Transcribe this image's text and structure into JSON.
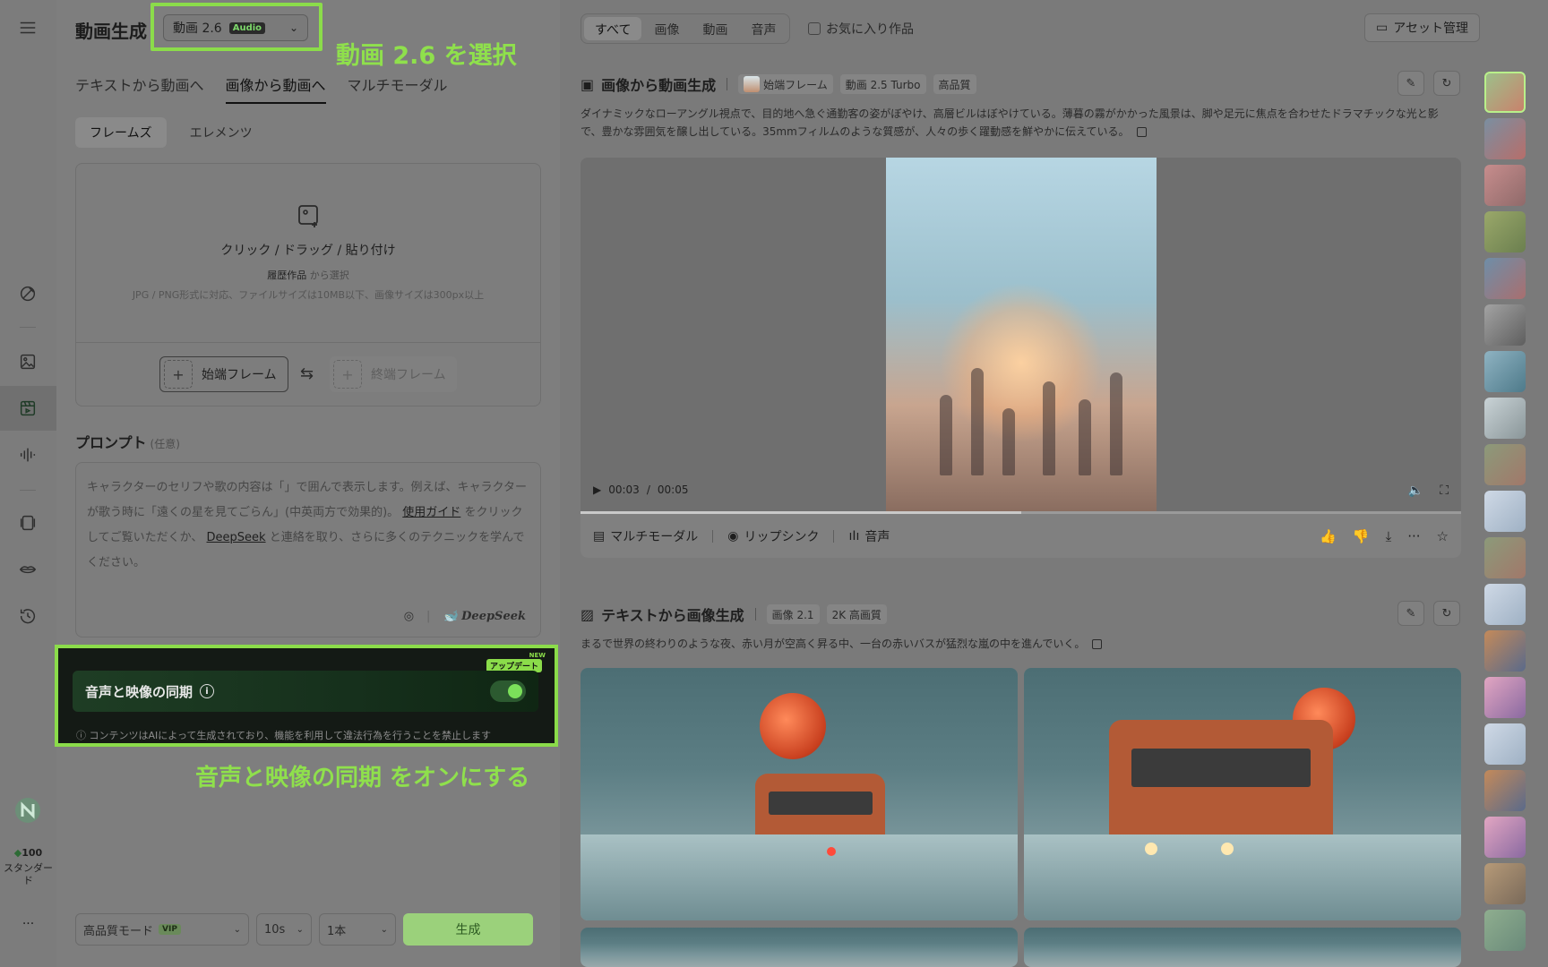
{
  "header": {
    "title": "動画生成",
    "model_label": "動画 2.6",
    "model_badge": "Audio"
  },
  "annotations": {
    "select_model": "動画 2.6 を選択",
    "enable_sync": "音声と映像の同期 をオンにする"
  },
  "mode_tabs": [
    {
      "label": "テキストから動画へ"
    },
    {
      "label": "画像から動画へ"
    },
    {
      "label": "マルチモーダル"
    }
  ],
  "sub_tabs": [
    {
      "label": "フレームズ"
    },
    {
      "label": "エレメンツ"
    }
  ],
  "upload": {
    "main": "クリック / ドラッグ / 貼り付け",
    "history_link": "履歴作品",
    "history_suffix": "から選択",
    "note": "JPG / PNG形式に対応、ファイルサイズは10MB以下、画像サイズは300px以上",
    "start_frame": "始端フレーム",
    "end_frame": "終端フレーム"
  },
  "prompt": {
    "label": "プロンプト",
    "optional": "(任意)",
    "placeholder_1": "キャラクターのセリフや歌の内容は「」で囲んで表示します。例えば、キャラクターが歌う時に「遠くの星を見てごらん」(中英両方で効果的)。",
    "guide_link": "使用ガイド",
    "placeholder_2": "をクリックしてご覧いただくか、",
    "deepseek_link": "DeepSeek",
    "placeholder_3": "と連絡を取り、さらに多くのテクニックを学んでください。",
    "deepseek_brand": "DeepSeek"
  },
  "sync": {
    "label": "音声と映像の同期",
    "info": "i",
    "update_badge": "アップデート",
    "new_tag": "NEW",
    "enabled": true,
    "disclaimer": "コンテンツはAIによって生成されており、機能を利用して違法行為を行うことを禁止します"
  },
  "bottom": {
    "quality": "高品質モード",
    "vip": "VIP",
    "duration": "10s",
    "count": "1本",
    "generate": "生成"
  },
  "sidebar": {
    "credits": "100",
    "plan": "スタンダード",
    "more": "···"
  },
  "filters": {
    "tabs": [
      {
        "label": "すべて"
      },
      {
        "label": "画像"
      },
      {
        "label": "動画"
      },
      {
        "label": "音声"
      }
    ],
    "favorites": "お気に入り作品",
    "asset_button": "アセット管理"
  },
  "video_card": {
    "title": "画像から動画生成",
    "chips": [
      "始端フレーム",
      "動画 2.5 Turbo",
      "高品質"
    ],
    "description": "ダイナミックなローアングル視点で、目的地へ急ぐ通勤客の姿がぼやけ、高層ビルはぼやけている。薄暮の霧がかかった風景は、脚や足元に焦点を合わせたドラマチックな光と影で、豊かな雰囲気を醸し出している。35mmフィルムのような質感が、人々の歩く躍動感を鮮やかに伝えている。",
    "time_current": "00:03",
    "time_sep": "/",
    "time_total": "00:05",
    "progress": 0.5,
    "actions": [
      "マルチモーダル",
      "リップシンク",
      "音声"
    ]
  },
  "image_card": {
    "title": "テキストから画像生成",
    "chips": [
      "画像 2.1",
      "2K 高画質"
    ],
    "description": "まるで世界の終わりのような夜、赤い月が空高く昇る中、一台の赤いバスが猛烈な嵐の中を進んでいく。"
  },
  "colors": {
    "accent_green": "#8bdc4a",
    "generate_bg": "#9bd17b",
    "toggle_on": "#7be05a"
  }
}
